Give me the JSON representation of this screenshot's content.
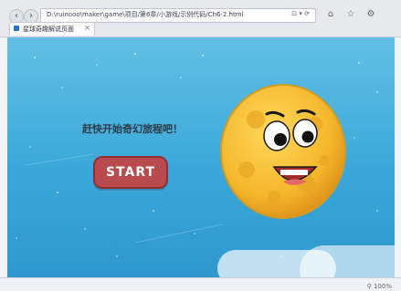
{
  "browser": {
    "address": "D:\\ruinooo\\maker\\game\\项目/第6章/小游戏/示例代码/Ch6-2.html",
    "tab_title": "星球奇趣解说页面",
    "address_actions": "⊡ ▾ ⟳",
    "zoom_text": "⚲ 100%"
  },
  "page": {
    "prompt": "赶快开始奇幻旅程吧！",
    "start_label": "START"
  },
  "colors": {
    "sky_top": "#63bfe4",
    "sky_bottom": "#2f97cd",
    "start_bg": "#b94a4e",
    "moon": "#f4b62b"
  },
  "icons": [
    "back-icon",
    "forward-icon",
    "home-icon",
    "star-icon",
    "gear-icon"
  ]
}
